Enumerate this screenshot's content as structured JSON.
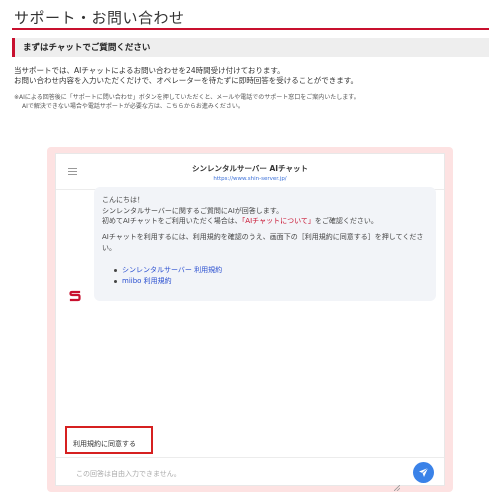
{
  "page": {
    "title": "サポート・お問い合わせ",
    "section_heading": "まずはチャットでご質問ください",
    "intro_line1": "当サポートでは、AIチャットによるお問い合わせを24時間受け付けております。",
    "intro_line2": "お問い合わせ内容を入力いただくだけで、オペレーターを待たずに即時回答を受けることができます。",
    "note_line1": "※AIによる回答後に「サポートに問い合わせ」ボタンを押していただくと、メールや電話でのサポート窓口をご案内いたします。",
    "note_line2": "AIで解決できない場合や電話サポートが必要な方は、こちらからお進みください。"
  },
  "chat": {
    "title": "シンレンタルサーバー AIチャット",
    "url": "https://www.shin-server.jp/",
    "message": {
      "greeting": "こんにちは！",
      "line2": "シンレンタルサーバーに関するご質問にAIが回答します。",
      "line3_before": "初めてAIチャットをご利用いただく場合は、",
      "line3_highlight": "「AIチャットについて」",
      "line3_after": "をご確認ください。",
      "terms_line1": "AIチャットを利用するには、利用規約を確認のうえ、画面下の［利用規約に同意する］を押してくださ",
      "terms_line2": "い。",
      "links": [
        "シンレンタルサーバー 利用規約",
        "miibo 利用規約"
      ]
    },
    "agree_button": "利用規約に同意する",
    "input_placeholder": "この回答は自由入力できません。"
  },
  "colors": {
    "accent_red": "#c8102e",
    "frame_pink": "#fde2e2",
    "link_blue": "#2a4fd0",
    "send_blue": "#3a82e8"
  }
}
